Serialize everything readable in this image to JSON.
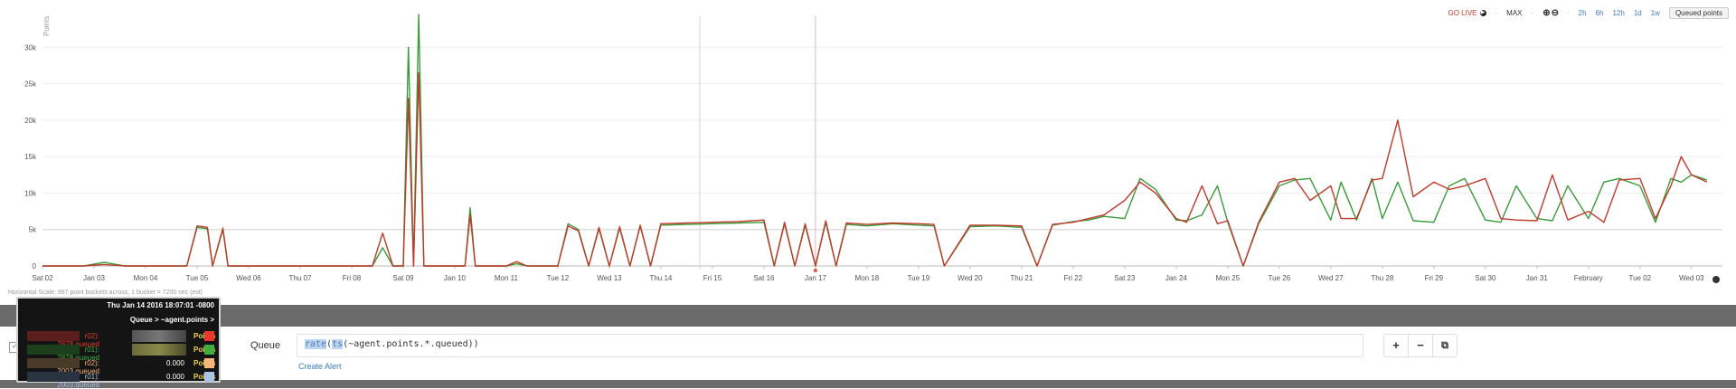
{
  "toolbar": {
    "go_live": "GO LIVE",
    "max": "MAX",
    "windows": [
      "2h",
      "6h",
      "12h",
      "1d",
      "1w"
    ],
    "series_button": "Queued points"
  },
  "scale_note": "Horizontal Scale: 997 point buckets across, 1 bucket = 7200 sec (est)",
  "chart_data": {
    "type": "line",
    "ylabel": "Points",
    "ylim": [
      0,
      35000
    ],
    "yticks": [
      0,
      5000,
      10000,
      15000,
      20000,
      25000,
      30000
    ],
    "ytick_labels": [
      "0",
      "5k",
      "10k",
      "15k",
      "20k",
      "25k",
      "30k"
    ],
    "x_start": "2016-01-02",
    "x_end": "2016-02-03",
    "xtick_labels": [
      "Sat 02",
      "Jan 03",
      "Mon 04",
      "Tue 05",
      "Wed 06",
      "Thu 07",
      "Fri 08",
      "Sat 09",
      "Jan 10",
      "Mon 11",
      "Tue 12",
      "Wed 13",
      "Thu 14",
      "Fri 15",
      "Sat 16",
      "Jan 17",
      "Mon 18",
      "Tue 19",
      "Wed 20",
      "Thu 21",
      "Fri 22",
      "Sat 23",
      "Jan 24",
      "Mon 25",
      "Tue 26",
      "Wed 27",
      "Thu 28",
      "Fri 29",
      "Sat 30",
      "Jan 31",
      "February",
      "Tue 02",
      "Wed 03"
    ],
    "markers": [
      "2016-01-14T18:07:01",
      "2016-01-17"
    ],
    "series": [
      {
        "color": "#c0392b",
        "x": [
          0,
          0.8,
          1.2,
          1.6,
          2.8,
          3.0,
          3.2,
          3.3,
          3.5,
          3.6,
          6.4,
          6.6,
          6.8,
          7.0,
          7.1,
          7.2,
          7.3,
          7.4,
          8.2,
          8.3,
          8.4,
          9.0,
          9.2,
          9.4,
          10.0,
          10.2,
          10.4,
          10.6,
          10.8,
          11.0,
          11.2,
          11.4,
          11.6,
          11.8,
          12.0,
          12.5,
          13.0,
          13.5,
          14.0,
          14.2,
          14.4,
          14.6,
          14.8,
          15.0,
          15.2,
          15.4,
          15.6,
          16.0,
          16.5,
          17.0,
          17.3,
          17.5,
          18.0,
          18.5,
          19.0,
          19.3,
          19.6,
          20.0,
          20.3,
          20.6,
          21.0,
          21.3,
          21.6,
          22.0,
          22.2,
          22.5,
          22.8,
          23.0,
          23.3,
          23.6,
          24.0,
          24.3,
          24.6,
          25.0,
          25.2,
          25.5,
          25.8,
          26.0,
          26.3,
          26.6,
          27.0,
          27.3,
          27.6,
          28.0,
          28.3,
          28.6,
          29.0,
          29.3,
          29.6,
          30.0,
          30.3,
          30.6,
          31.0,
          31.3,
          31.6,
          31.8,
          32.0,
          32.3
        ],
        "y": [
          0,
          0,
          200,
          0,
          0,
          5500,
          5300,
          0,
          5200,
          0,
          0,
          4500,
          0,
          0,
          23000,
          0,
          26500,
          0,
          0,
          7000,
          0,
          0,
          600,
          0,
          0,
          5500,
          4800,
          0,
          5300,
          0,
          5400,
          0,
          5600,
          0,
          5800,
          5900,
          6000,
          6100,
          6300,
          0,
          6000,
          0,
          5800,
          0,
          6200,
          0,
          5900,
          5700,
          5900,
          5800,
          5700,
          0,
          5600,
          5600,
          5500,
          0,
          5700,
          6000,
          6500,
          7000,
          9000,
          11500,
          10000,
          6500,
          6000,
          11000,
          5800,
          6200,
          0,
          6000,
          11500,
          12000,
          9000,
          11000,
          6500,
          6500,
          11800,
          12000,
          20000,
          9500,
          11500,
          10500,
          11000,
          12000,
          6500,
          6300,
          6200,
          12500,
          6300,
          7500,
          6000,
          11800,
          12000,
          6500,
          11000,
          15000,
          12500,
          11500
        ]
      },
      {
        "color": "#3a9a3a",
        "x": [
          0,
          0.8,
          1.2,
          1.6,
          2.8,
          3.0,
          3.2,
          3.3,
          3.5,
          3.6,
          6.4,
          6.6,
          6.8,
          7.0,
          7.1,
          7.2,
          7.3,
          7.4,
          8.2,
          8.3,
          8.4,
          9.0,
          9.2,
          9.4,
          10.0,
          10.2,
          10.4,
          10.6,
          10.8,
          11.0,
          11.2,
          11.4,
          11.6,
          11.8,
          12.0,
          12.5,
          13.0,
          13.5,
          14.0,
          14.2,
          14.4,
          14.6,
          14.8,
          15.0,
          15.2,
          15.4,
          15.6,
          16.0,
          16.5,
          17.0,
          17.3,
          17.5,
          18.0,
          18.5,
          19.0,
          19.3,
          19.6,
          20.0,
          20.3,
          20.6,
          21.0,
          21.3,
          21.6,
          22.0,
          22.2,
          22.5,
          22.8,
          23.0,
          23.3,
          23.6,
          24.0,
          24.3,
          24.6,
          25.0,
          25.2,
          25.5,
          25.8,
          26.0,
          26.3,
          26.6,
          27.0,
          27.3,
          27.6,
          28.0,
          28.3,
          28.6,
          29.0,
          29.3,
          29.6,
          30.0,
          30.3,
          30.6,
          31.0,
          31.3,
          31.6,
          31.8,
          32.0,
          32.3
        ],
        "y": [
          0,
          0,
          500,
          0,
          0,
          5300,
          5100,
          0,
          5000,
          0,
          0,
          2500,
          0,
          0,
          30000,
          0,
          34500,
          0,
          0,
          8000,
          0,
          0,
          300,
          0,
          0,
          5800,
          5000,
          0,
          5100,
          0,
          5200,
          0,
          5500,
          0,
          5600,
          5700,
          5800,
          5900,
          6000,
          0,
          5800,
          0,
          5600,
          0,
          6000,
          0,
          5700,
          5500,
          5800,
          5600,
          5500,
          0,
          5400,
          5500,
          5300,
          0,
          5600,
          6100,
          6300,
          6800,
          6500,
          12000,
          10500,
          6300,
          6200,
          7000,
          11000,
          6000,
          0,
          5800,
          11000,
          11800,
          12000,
          6300,
          11500,
          6300,
          12000,
          6500,
          11500,
          6200,
          6000,
          11000,
          12000,
          6300,
          6000,
          11000,
          6500,
          6200,
          11000,
          6500,
          11500,
          12000,
          11000,
          6000,
          12000,
          11500,
          12500,
          11800
        ]
      }
    ]
  },
  "tooltip": {
    "timestamp": "Thu Jan 14 2016 18:07:01 -0800",
    "query_path": "Queue > ~agent.points >",
    "rows": [
      {
        "host": "r02):",
        "metric": "2878.queued",
        "value": "",
        "unit": "Points",
        "color": "#e8382e"
      },
      {
        "host": "r01):",
        "metric": "2878.queued",
        "value": "",
        "unit": "Points",
        "color": "#3fae3f"
      },
      {
        "host": "r02):",
        "metric": "2003.queued",
        "value": "0.000",
        "unit": "Points",
        "color": "#f5b67a"
      },
      {
        "host": "r01):",
        "metric": "2003.queued",
        "value": "0.000",
        "unit": "Points",
        "color": "#a9c4e6"
      }
    ]
  },
  "query": {
    "name": "Queue",
    "func": "rate",
    "paren_open": "(",
    "ts": "ts",
    "rest": "(~agent.points.*.queued))",
    "create_alert": "Create Alert",
    "add_label": "+",
    "remove_label": "−",
    "copy_label": "⧉",
    "collapse_label": "✓"
  }
}
